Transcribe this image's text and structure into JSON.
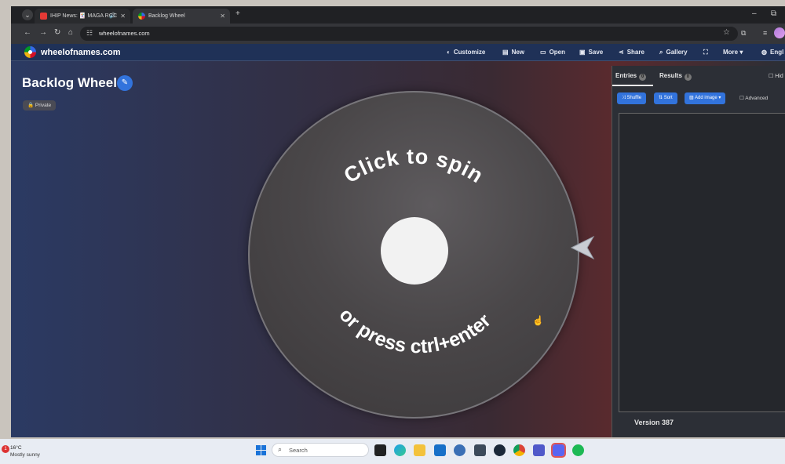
{
  "browser": {
    "tabs": [
      {
        "title": "IHIP News: 🃏 MAGA ROC",
        "favicon_color": "#e53935",
        "audio": true
      },
      {
        "title": "Backlog Wheel",
        "favicon_color": "#4285f4",
        "active": true
      }
    ],
    "new_tab": "+",
    "address": "wheelofnames.com",
    "icons": [
      "tab-search-icon",
      "back-icon",
      "forward-icon",
      "reload-icon",
      "home-icon",
      "site-info-icon",
      "bookmark-star-icon",
      "extensions-icon",
      "profile-icon"
    ]
  },
  "site": {
    "name": "wheelofnames.com",
    "menu": [
      {
        "label": "Customize",
        "icon": "palette-icon"
      },
      {
        "label": "New",
        "icon": "new-file-icon"
      },
      {
        "label": "Open",
        "icon": "folder-open-icon"
      },
      {
        "label": "Save",
        "icon": "save-icon"
      },
      {
        "label": "Share",
        "icon": "share-icon"
      },
      {
        "label": "Gallery",
        "icon": "search-icon"
      },
      {
        "label": "",
        "icon": "fullscreen-icon"
      },
      {
        "label": "More",
        "icon": "chevron-down-icon"
      },
      {
        "label": "Engl",
        "icon": "globe-icon"
      }
    ]
  },
  "wheel": {
    "title": "Backlog Wheel",
    "privacy_badge": "Private",
    "spin_text_top": "Click to spin",
    "spin_text_bottom": "or press ctrl+enter"
  },
  "panel": {
    "tabs": [
      {
        "label": "Entries",
        "count": "0"
      },
      {
        "label": "Results",
        "count": "0"
      }
    ],
    "hide_label": "Hid",
    "toolbar": [
      "Shuffle",
      "Sort",
      "Add image"
    ],
    "advanced_label": "Advanced",
    "version": "Version 387"
  },
  "taskbar": {
    "weather_badge": "1",
    "temperature": "16°C",
    "condition": "Mostly sunny",
    "search_placeholder": "Search",
    "apps": [
      "edge-icon",
      "file-explorer-icon",
      "outlook-icon",
      "fingerprint-icon",
      "shield-icon",
      "steam-icon",
      "chrome-icon",
      "teams-icon",
      "discord-icon",
      "spotify-icon"
    ]
  },
  "colors": {
    "accent": "#3273dc",
    "site_bar": "#1f3157",
    "wheel_fill": "#4a4749"
  }
}
